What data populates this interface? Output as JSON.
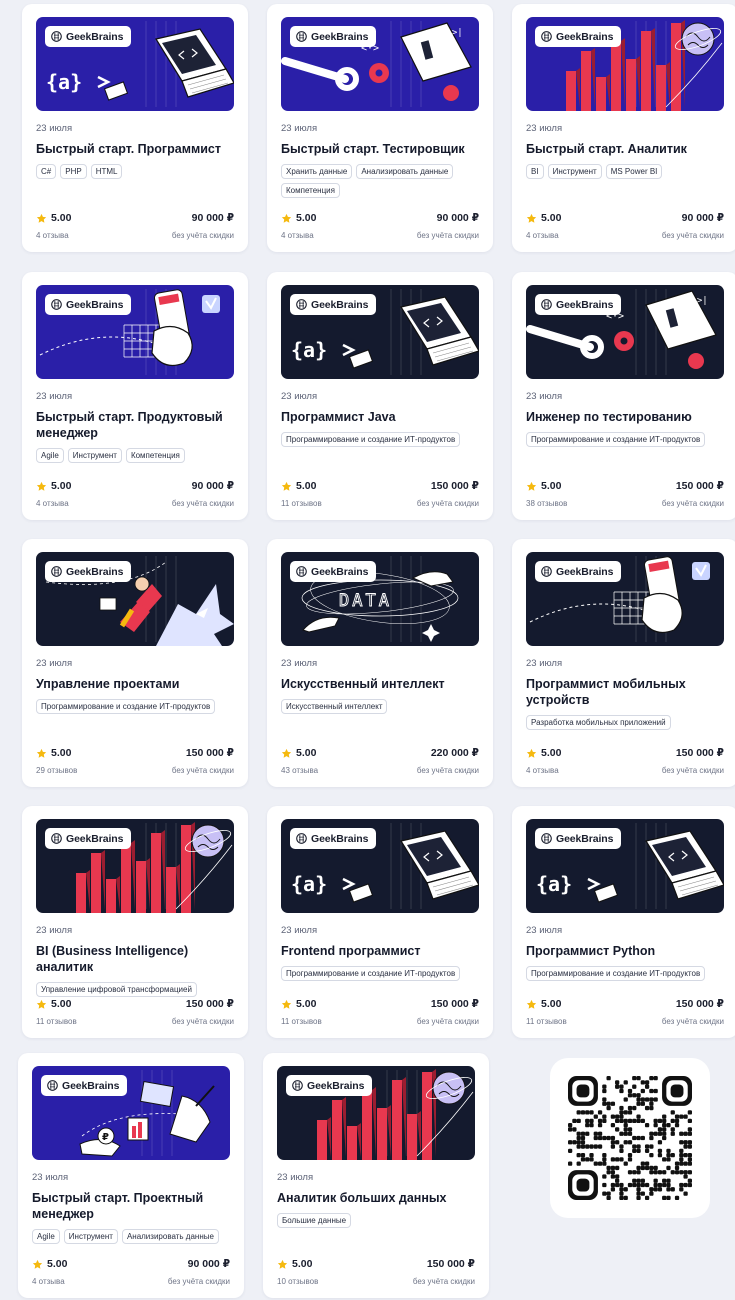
{
  "brand_name": "GeekBrains",
  "cards": [
    {
      "date": "23 июля",
      "title": "Быстрый старт. Программист",
      "tags": [
        "C#",
        "PHP",
        "HTML"
      ],
      "rating": "5.00",
      "price": "90 000 ₽",
      "reviews": "4 отзыва",
      "discount_note": "без учёта скидки",
      "theme": "blue",
      "art": "laptop"
    },
    {
      "date": "23 июля",
      "title": "Быстрый старт. Тестировщик",
      "tags": [
        "Хранить данные",
        "Анализировать данные",
        "Компетенция"
      ],
      "rating": "5.00",
      "price": "90 000 ₽",
      "reviews": "4 отзыва",
      "discount_note": "без учёта скидки",
      "theme": "blue",
      "art": "testing"
    },
    {
      "date": "23 июля",
      "title": "Быстрый старт. Аналитик",
      "tags": [
        "BI",
        "Инструмент",
        "MS Power BI"
      ],
      "rating": "5.00",
      "price": "90 000 ₽",
      "reviews": "4 отзыва",
      "discount_note": "без учёта скидки",
      "theme": "blue",
      "art": "bars"
    },
    {
      "date": "23 июля",
      "title": "Быстрый старт. Продуктовый менеджер",
      "tags": [
        "Agile",
        "Инструмент",
        "Компетенция"
      ],
      "rating": "5.00",
      "price": "90 000 ₽",
      "reviews": "4 отзыва",
      "discount_note": "без учёта скидки",
      "theme": "blue",
      "art": "phone"
    },
    {
      "date": "23 июля",
      "title": "Программист Java",
      "tags": [
        "Программирование и создание ИТ-продуктов"
      ],
      "rating": "5.00",
      "price": "150 000 ₽",
      "reviews": "11 отзывов",
      "discount_note": "без учёта скидки",
      "theme": "dark",
      "art": "laptop"
    },
    {
      "date": "23 июля",
      "title": "Инженер по тестированию",
      "tags": [
        "Программирование и создание ИТ-продуктов"
      ],
      "rating": "5.00",
      "price": "150 000 ₽",
      "reviews": "38 отзывов",
      "discount_note": "без учёта скидки",
      "theme": "dark",
      "art": "testing"
    },
    {
      "date": "23 июля",
      "title": "Управление проектами",
      "tags": [
        "Программирование и создание ИТ-продуктов"
      ],
      "rating": "5.00",
      "price": "150 000 ₽",
      "reviews": "29 отзывов",
      "discount_note": "без учёта скидки",
      "theme": "dark",
      "art": "rocket"
    },
    {
      "date": "23 июля",
      "title": "Искусственный интеллект",
      "tags": [
        "Искусственный интеллект"
      ],
      "rating": "5.00",
      "price": "220 000 ₽",
      "reviews": "43 отзыва",
      "discount_note": "без учёта скидки",
      "theme": "dark",
      "art": "data",
      "art_text": "DATA"
    },
    {
      "date": "23 июля",
      "title": "Программист мобильных устройств",
      "tags": [
        "Разработка мобильных приложений"
      ],
      "rating": "5.00",
      "price": "150 000 ₽",
      "reviews": "4 отзыва",
      "discount_note": "без учёта скидки",
      "theme": "dark",
      "art": "phone"
    },
    {
      "date": "23 июля",
      "title": "BI (Business Intelligence) аналитик",
      "tags": [
        "Управление цифровой трансформацией"
      ],
      "rating": "5.00",
      "price": "150 000 ₽",
      "reviews": "11 отзывов",
      "discount_note": "без учёта скидки",
      "theme": "dark",
      "art": "bars"
    },
    {
      "date": "23 июля",
      "title": "Frontend программист",
      "tags": [
        "Программирование и создание ИТ-продуктов"
      ],
      "rating": "5.00",
      "price": "150 000 ₽",
      "reviews": "11 отзывов",
      "discount_note": "без учёта скидки",
      "theme": "dark",
      "art": "laptop"
    },
    {
      "date": "23 июля",
      "title": "Программист Python",
      "tags": [
        "Программирование и создание ИТ-продуктов"
      ],
      "rating": "5.00",
      "price": "150 000 ₽",
      "reviews": "11 отзывов",
      "discount_note": "без учёта скидки",
      "theme": "dark",
      "art": "laptop"
    },
    {
      "date": "23 июля",
      "title": "Быстрый старт. Проектный менеджер",
      "tags": [
        "Agile",
        "Инструмент",
        "Анализировать данные"
      ],
      "rating": "5.00",
      "price": "90 000 ₽",
      "reviews": "4 отзыва",
      "discount_note": "без учёта скидки",
      "theme": "blue",
      "art": "manager"
    },
    {
      "date": "23 июля",
      "title": "Аналитик больших данных",
      "tags": [
        "Большие данные"
      ],
      "rating": "5.00",
      "price": "150 000 ₽",
      "reviews": "10 отзывов",
      "discount_note": "без учёта скидки",
      "theme": "dark",
      "art": "bars"
    }
  ],
  "colors": {
    "theme_blue": "#2a1fa8",
    "theme_dark": "#141a2e",
    "accent_red": "#e8384f",
    "star": "#f5b90f",
    "accent_lilac": "#c8c0f5"
  },
  "icons": {
    "brand": "geekbrains-logo-icon",
    "rating": "star-icon",
    "qr": "qr-code-icon"
  }
}
